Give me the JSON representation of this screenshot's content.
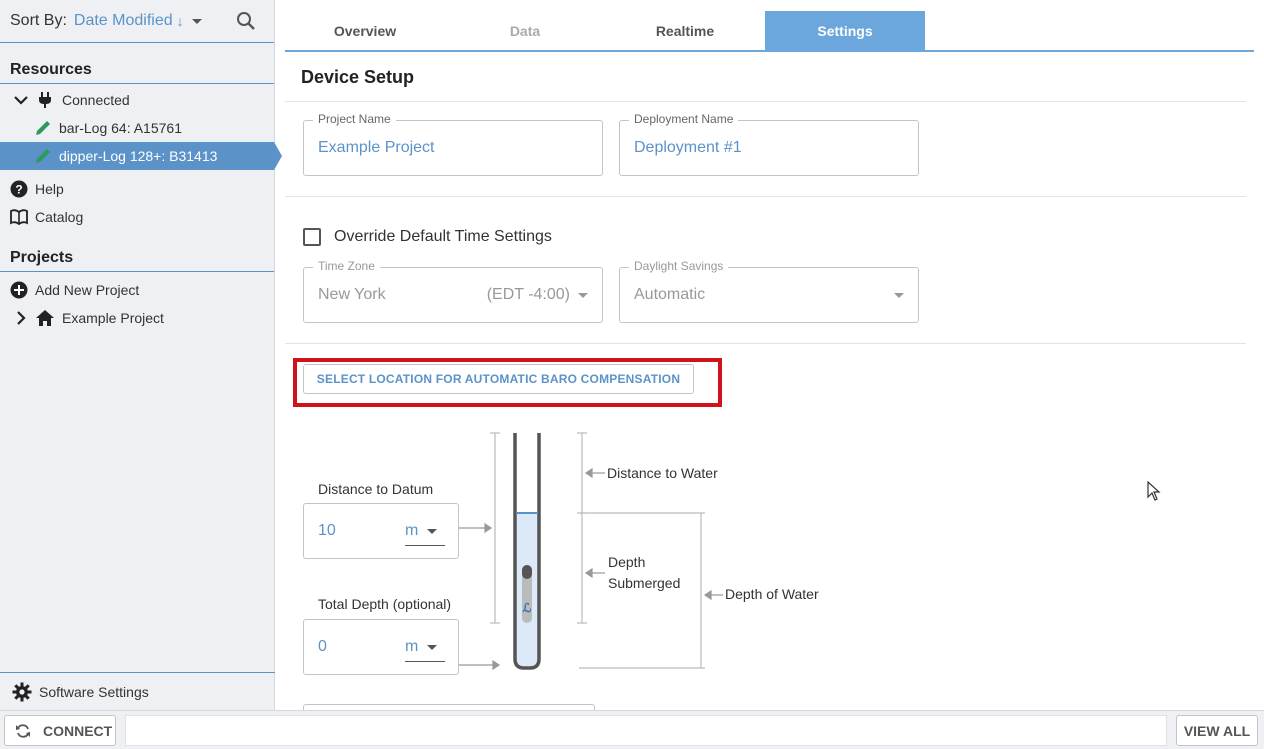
{
  "sidebar": {
    "sort_label": "Sort By:",
    "sort_value": "Date Modified",
    "sort_direction": "↓",
    "resources_heading": "Resources",
    "connected_label": "Connected",
    "devices": [
      {
        "label": "bar-Log 64: A15761"
      },
      {
        "label": "dipper-Log 128+: B31413"
      }
    ],
    "help_label": "Help",
    "catalog_label": "Catalog",
    "projects_heading": "Projects",
    "add_project_label": "Add New Project",
    "example_project_label": "Example Project",
    "software_settings_label": "Software Settings"
  },
  "tabs": [
    {
      "label": "Overview"
    },
    {
      "label": "Data"
    },
    {
      "label": "Realtime"
    },
    {
      "label": "Settings"
    }
  ],
  "device_setup": {
    "title": "Device Setup",
    "project_name_label": "Project Name",
    "project_name_value": "Example Project",
    "deployment_name_label": "Deployment Name",
    "deployment_name_value": "Deployment #1",
    "override_label": "Override Default Time Settings",
    "time_zone_label": "Time Zone",
    "time_zone_value": "New York",
    "time_zone_offset": "(EDT -4:00)",
    "daylight_label": "Daylight Savings",
    "daylight_value": "Automatic",
    "baro_button": "SELECT LOCATION FOR AUTOMATIC BARO COMPENSATION",
    "distance_to_datum_label": "Distance to Datum",
    "distance_to_datum_value": "10",
    "distance_to_datum_unit": "m",
    "total_depth_label": "Total Depth (optional)",
    "total_depth_value": "0",
    "total_depth_unit": "m",
    "diagram": {
      "distance_to_water": "Distance to Water",
      "depth_submerged_1": "Depth",
      "depth_submerged_2": "Submerged",
      "depth_of_water": "Depth of Water"
    }
  },
  "bottombar": {
    "connect_label": "CONNECT",
    "view_all_label": "VIEW ALL"
  },
  "colors": {
    "accent": "#5b93c9",
    "tab_active": "#6ba6dc",
    "highlight": "#d0121b",
    "water": "#dce9f8"
  }
}
